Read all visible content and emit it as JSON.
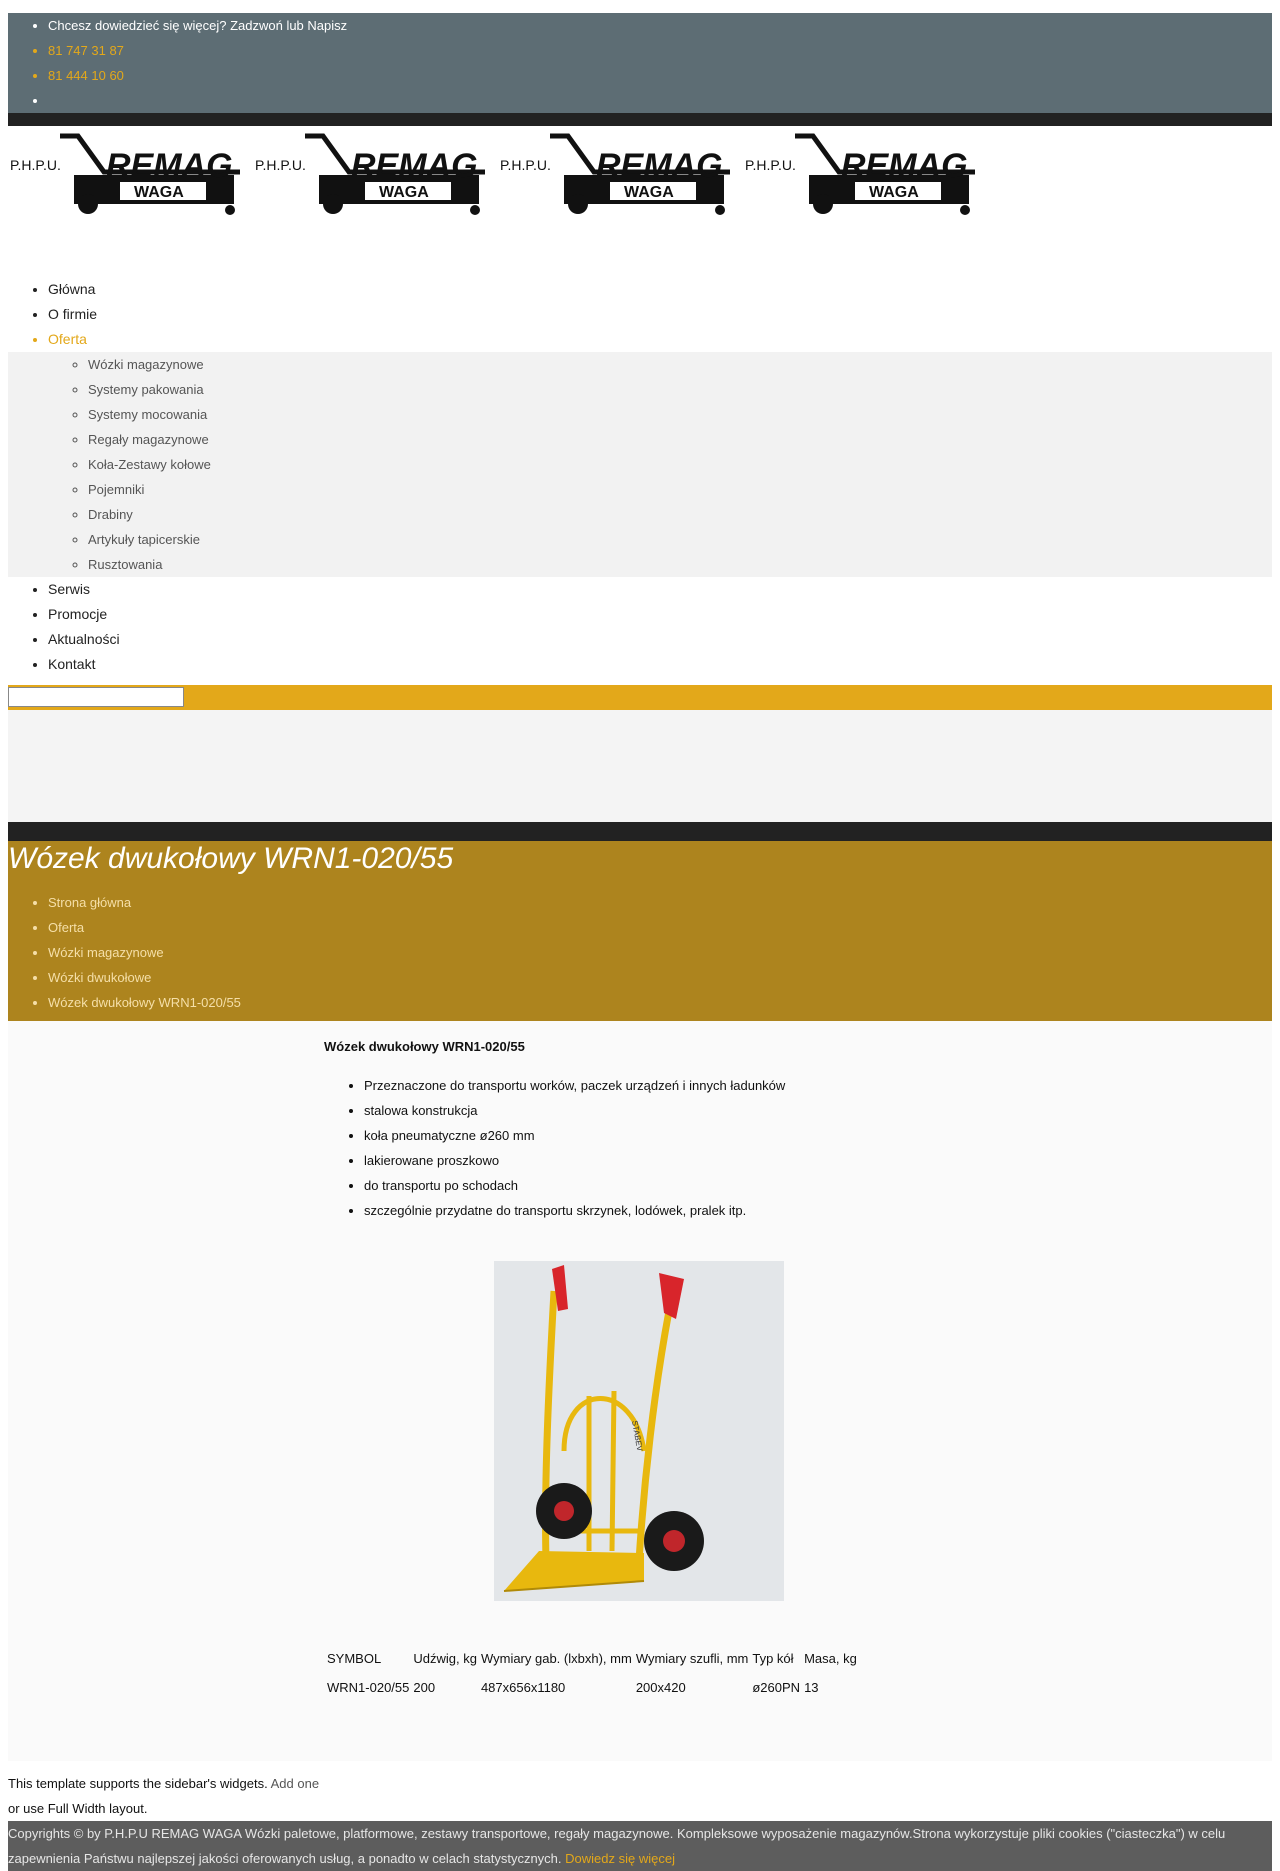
{
  "topbar": {
    "tagline": "Chcesz dowiedzieć się więcej? Zadzwoń lub Napisz",
    "phone1": "81 747 31 87",
    "phone2": "81 444 10 60",
    "empty": ""
  },
  "logo": {
    "prefix": "P.H.P.U.",
    "brand": "REMAG",
    "sub": "WAGA"
  },
  "nav": {
    "items": [
      {
        "label": "Główna"
      },
      {
        "label": "O firmie"
      },
      {
        "label": "Oferta"
      },
      {
        "label": "Serwis"
      },
      {
        "label": "Promocje"
      },
      {
        "label": "Aktualności"
      },
      {
        "label": "Kontakt"
      }
    ],
    "submenu": [
      {
        "label": "Wózki magazynowe"
      },
      {
        "label": "Systemy pakowania"
      },
      {
        "label": "Systemy mocowania"
      },
      {
        "label": "Regały magazynowe"
      },
      {
        "label": "Koła-Zestawy kołowe"
      },
      {
        "label": "Pojemniki"
      },
      {
        "label": "Drabiny"
      },
      {
        "label": "Artykuły tapicerskie"
      },
      {
        "label": "Rusztowania"
      }
    ]
  },
  "search": {
    "value": ""
  },
  "page": {
    "title": "Wózek dwukołowy WRN1-020/55",
    "breadcrumb": [
      {
        "label": "Strona główna"
      },
      {
        "label": "Oferta"
      },
      {
        "label": "Wózki magazynowe"
      },
      {
        "label": "Wózki dwukołowe"
      },
      {
        "label": "Wózek dwukołowy WRN1-020/55"
      }
    ]
  },
  "product": {
    "title": "Wózek dwukołowy WRN1-020/55",
    "features": [
      "Przeznaczone do transportu worków, paczek urządzeń i innych ładunków",
      "stalowa konstrukcja",
      "koła pneumatyczne ø260 mm",
      "lakierowane proszkowo",
      "do transportu po schodach",
      "szczególnie przydatne do transportu skrzynek, lodówek, pralek itp."
    ],
    "image_label": "STABEV",
    "spec": {
      "headers": [
        "SYMBOL",
        "Udźwig, kg",
        "Wymiary gab. (lxbxh), mm",
        "Wymiary szufli, mm",
        "Typ kół",
        "Masa, kg"
      ],
      "row": [
        "WRN1-020/55",
        "200",
        "487x656x1180",
        "200x420",
        "ø260PN",
        "13"
      ]
    }
  },
  "sidebar": {
    "text1": "This template supports the sidebar's widgets.",
    "link": "Add one",
    "text2": "or use Full Width layout."
  },
  "footer": {
    "text": "Copyrights © by P.H.P.U REMAG WAGA Wózki paletowe, platformowe, zestawy transportowe, regały magazynowe. Kompleksowe wyposażenie magazynów.Strona wykorzystuje pliki cookies (\"ciasteczka\") w celu zapewnienia Państwu najlepszej jakości oferowanych usług, a ponadto w celach statystycznych.",
    "more": "Dowiedz się więcej"
  },
  "colors": {
    "topbar": "#5d6d74",
    "accent": "#e3a81a",
    "banner": "#ad841e",
    "footer": "#5d5d5d"
  }
}
